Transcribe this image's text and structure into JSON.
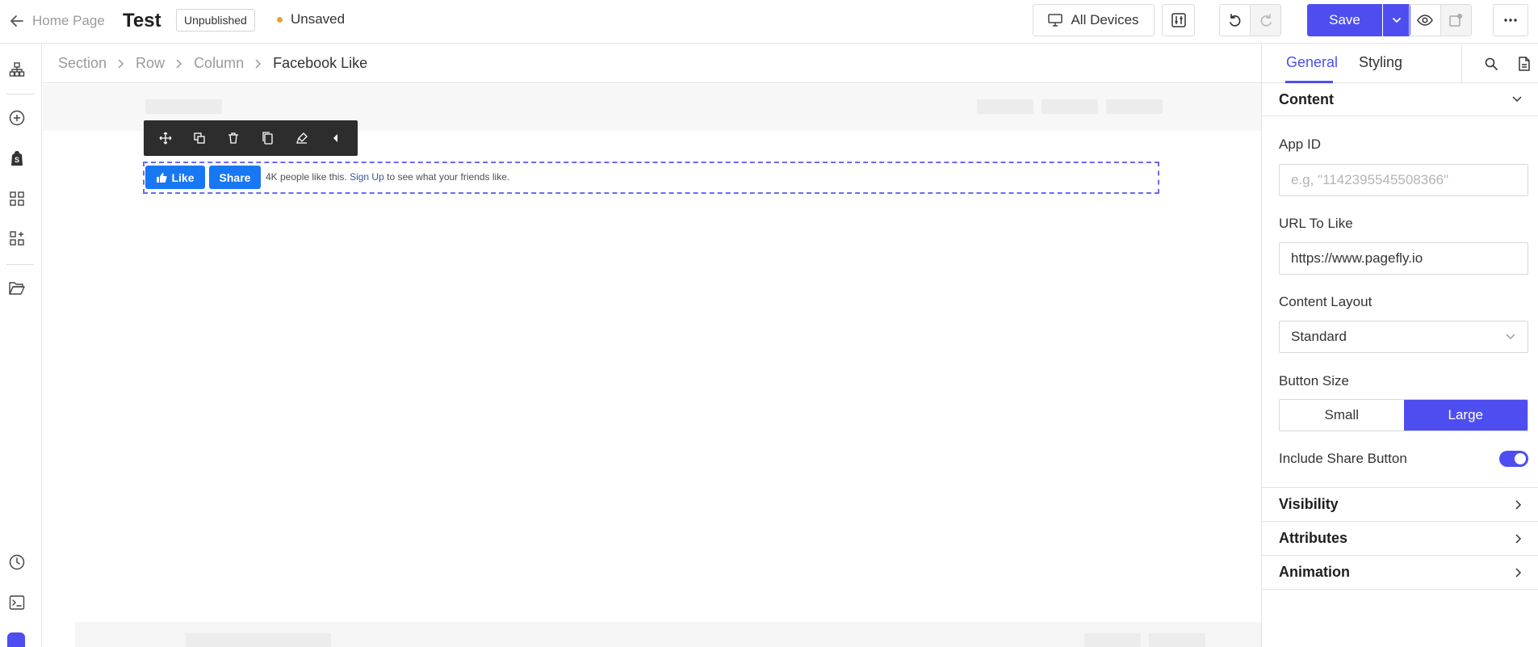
{
  "topbar": {
    "back_label": "Home Page",
    "page_title": "Test",
    "status_badge": "Unpublished",
    "save_state": "Unsaved",
    "device_selector": "All Devices",
    "save_label": "Save",
    "icons": {
      "back": "arrow-left-icon",
      "devices": "monitor-icon",
      "tune": "sliders-icon",
      "undo": "undo-icon",
      "redo": "redo-icon",
      "save_options": "chevron-down-icon",
      "preview": "eye-icon",
      "publish": "publish-icon",
      "more": "more-horizontal-icon"
    },
    "accent_color": "#4e4ef0",
    "unsaved_dot_color": "#e8a23a"
  },
  "left_rail": {
    "icons": [
      "sitemap-icon",
      "add-circle-icon",
      "shopify-bag-icon",
      "grid-icon",
      "grid-plus-icon",
      "folder-open-icon",
      "history-icon",
      "terminal-icon",
      "brand-logo-icon"
    ]
  },
  "breadcrumb": {
    "items": [
      "Section",
      "Row",
      "Column",
      "Facebook Like"
    ]
  },
  "element_toolbar": {
    "icons": [
      "move-icon",
      "duplicate-icon",
      "delete-icon",
      "copy-icon",
      "style-brush-icon",
      "collapse-left-icon"
    ]
  },
  "facebook_widget": {
    "like_label": "Like",
    "share_label": "Share",
    "social_text": "4K people like this.",
    "signup_link": "Sign Up",
    "signup_suffix": "to see what your friends like.",
    "button_color": "#1877f2"
  },
  "panel": {
    "tabs": [
      "General",
      "Styling"
    ],
    "active_tab": "General",
    "icons": [
      "search-icon",
      "document-icon"
    ],
    "content_section": {
      "title": "Content",
      "app_id_label": "App ID",
      "app_id_placeholder": "e.g, \"1142395545508366\"",
      "app_id_value": "",
      "url_label": "URL To Like",
      "url_value": "https://www.pagefly.io",
      "layout_label": "Content Layout",
      "layout_value": "Standard",
      "button_size_label": "Button Size",
      "button_size_options": [
        "Small",
        "Large"
      ],
      "button_size_selected": "Large",
      "share_button_label": "Include Share Button",
      "share_button_on": true
    },
    "sections": [
      "Visibility",
      "Attributes",
      "Animation"
    ]
  }
}
